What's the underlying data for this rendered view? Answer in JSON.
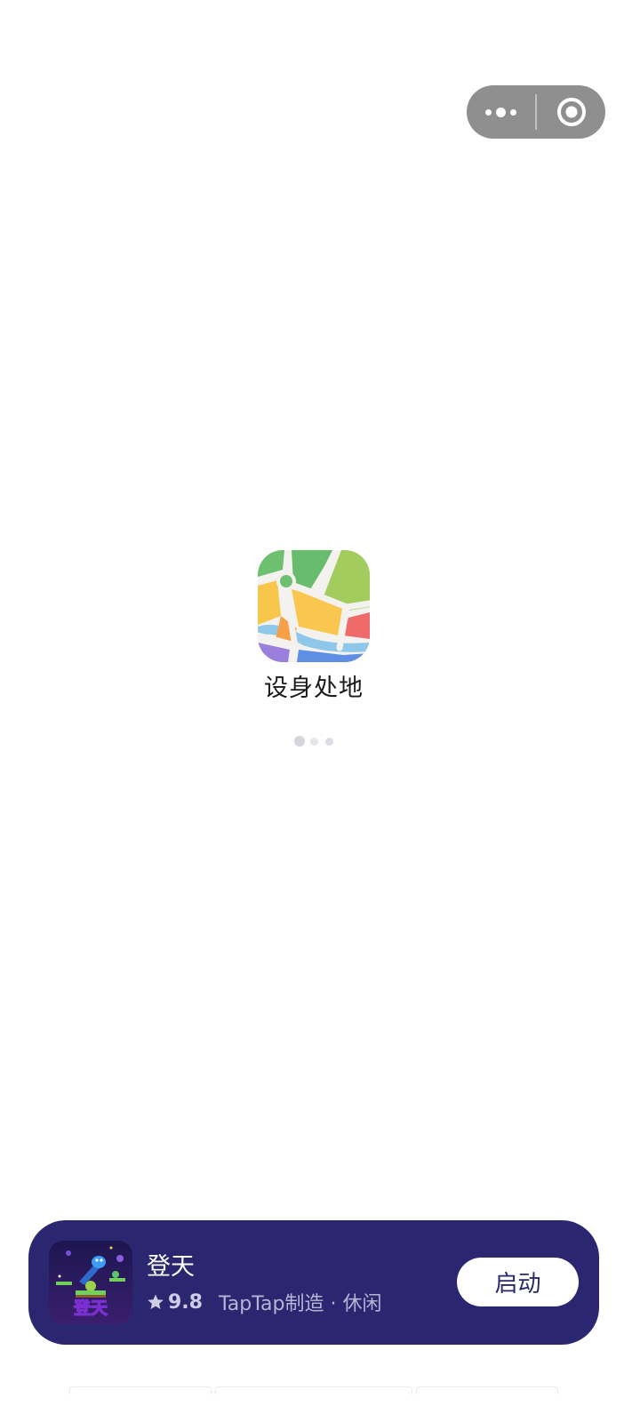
{
  "capsule": {
    "more_icon": "more-dots-icon",
    "close_icon": "target-circle-icon",
    "background_color": "#8f8f8f"
  },
  "splash": {
    "app_name": "设身处地",
    "app_icon": "colorful-map-icon"
  },
  "promo": {
    "game_name": "登天",
    "game_icon_text": "登天",
    "rating": "9.8",
    "meta": "TapTap制造 · 休闲",
    "launch_label": "启动",
    "background_color": "#2b2670"
  }
}
